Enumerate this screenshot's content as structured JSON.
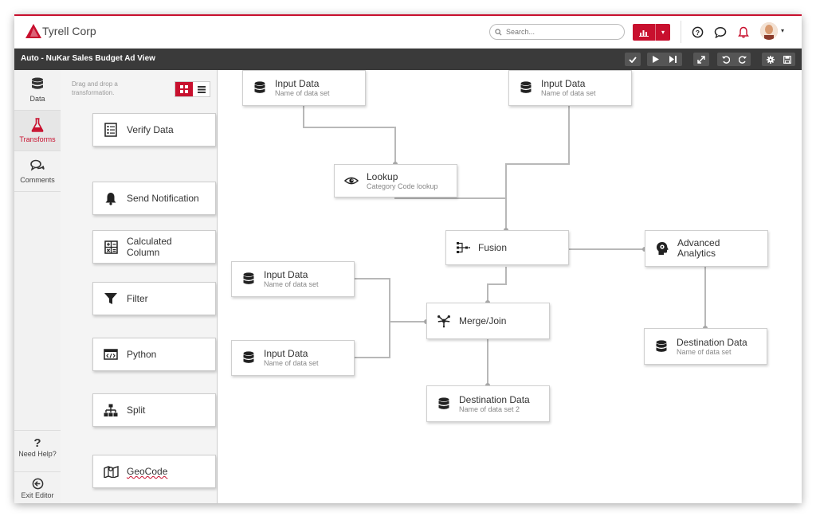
{
  "header": {
    "brand": "Tyrell Corp",
    "search_placeholder": "Search...",
    "accent": "#c8102e"
  },
  "toolbar": {
    "view_title": "Auto - NuKar Sales Budget Ad View"
  },
  "leftnav": {
    "items": [
      {
        "label": "Data",
        "icon": "database-icon"
      },
      {
        "label": "Transforms",
        "icon": "flask-icon",
        "active": true
      },
      {
        "label": "Comments",
        "icon": "comments-icon"
      }
    ],
    "help_label": "Need Help?",
    "exit_label": "Exit Editor"
  },
  "palette": {
    "hint": "Drag and drop a transformation.",
    "cards": [
      {
        "label": "Verify Data",
        "icon": "checklist-icon"
      },
      {
        "label": "Send Notification",
        "icon": "bell-icon"
      },
      {
        "label": "Calculated Column",
        "icon": "calculator-icon"
      },
      {
        "label": "Filter",
        "icon": "filter-icon"
      },
      {
        "label": "Python",
        "icon": "code-icon"
      },
      {
        "label": "Split",
        "icon": "split-icon"
      },
      {
        "label": "GeoCode",
        "icon": "map-icon"
      }
    ]
  },
  "canvas": {
    "nodes": {
      "input1": {
        "title": "Input Data",
        "sub": "Name of data set"
      },
      "input2": {
        "title": "Input Data",
        "sub": "Name of data set"
      },
      "lookup": {
        "title": "Lookup",
        "sub": "Category Code lookup"
      },
      "fusion": {
        "title": "Fusion"
      },
      "analytics": {
        "title": "Advanced Analytics"
      },
      "input3": {
        "title": "Input Data",
        "sub": "Name of data set"
      },
      "input4": {
        "title": "Input Data",
        "sub": "Name of data set"
      },
      "merge": {
        "title": "Merge/Join"
      },
      "dest1": {
        "title": "Destination Data",
        "sub": "Name of data set"
      },
      "dest2": {
        "title": "Destination Data",
        "sub": "Name of data set 2"
      }
    }
  }
}
